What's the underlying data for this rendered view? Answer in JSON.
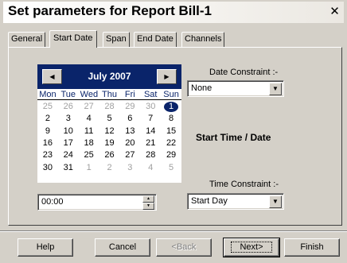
{
  "window": {
    "title": "Set parameters for Report Bill-1",
    "close_label": "✕"
  },
  "tabs": [
    {
      "label": "General"
    },
    {
      "label": "Start Date"
    },
    {
      "label": "Span"
    },
    {
      "label": "End Date"
    },
    {
      "label": "Channels"
    }
  ],
  "active_tab": "Start Date",
  "calendar": {
    "month_label": "July 2007",
    "prev_icon": "triangle-left",
    "next_icon": "triangle-right",
    "weekdays": [
      "Mon",
      "Tue",
      "Wed",
      "Thu",
      "Fri",
      "Sat",
      "Sun"
    ],
    "weeks": [
      [
        {
          "d": "25",
          "o": true
        },
        {
          "d": "26",
          "o": true
        },
        {
          "d": "27",
          "o": true
        },
        {
          "d": "28",
          "o": true
        },
        {
          "d": "29",
          "o": true
        },
        {
          "d": "30",
          "o": true
        },
        {
          "d": "1",
          "s": true
        }
      ],
      [
        {
          "d": "2"
        },
        {
          "d": "3"
        },
        {
          "d": "4"
        },
        {
          "d": "5"
        },
        {
          "d": "6"
        },
        {
          "d": "7"
        },
        {
          "d": "8"
        }
      ],
      [
        {
          "d": "9"
        },
        {
          "d": "10"
        },
        {
          "d": "11"
        },
        {
          "d": "12"
        },
        {
          "d": "13"
        },
        {
          "d": "14"
        },
        {
          "d": "15"
        }
      ],
      [
        {
          "d": "16"
        },
        {
          "d": "17"
        },
        {
          "d": "18"
        },
        {
          "d": "19"
        },
        {
          "d": "20"
        },
        {
          "d": "21"
        },
        {
          "d": "22"
        }
      ],
      [
        {
          "d": "23"
        },
        {
          "d": "24"
        },
        {
          "d": "25"
        },
        {
          "d": "26"
        },
        {
          "d": "27"
        },
        {
          "d": "28"
        },
        {
          "d": "29"
        }
      ],
      [
        {
          "d": "30"
        },
        {
          "d": "31"
        },
        {
          "d": "1",
          "o": true
        },
        {
          "d": "2",
          "o": true
        },
        {
          "d": "3",
          "o": true
        },
        {
          "d": "4",
          "o": true
        },
        {
          "d": "5",
          "o": true
        }
      ]
    ],
    "selected_date": "1",
    "accent_color": "#0a246a"
  },
  "time_input": {
    "value": "00:00"
  },
  "date_constraint": {
    "label": "Date Constraint :-",
    "value": "None"
  },
  "start_heading": "Start Time / Date",
  "time_constraint": {
    "label": "Time Constraint :-",
    "value": "Start Day"
  },
  "buttons": {
    "help": "Help",
    "cancel": "Cancel",
    "back": "<Back",
    "next": "Next>",
    "finish": "Finish"
  }
}
